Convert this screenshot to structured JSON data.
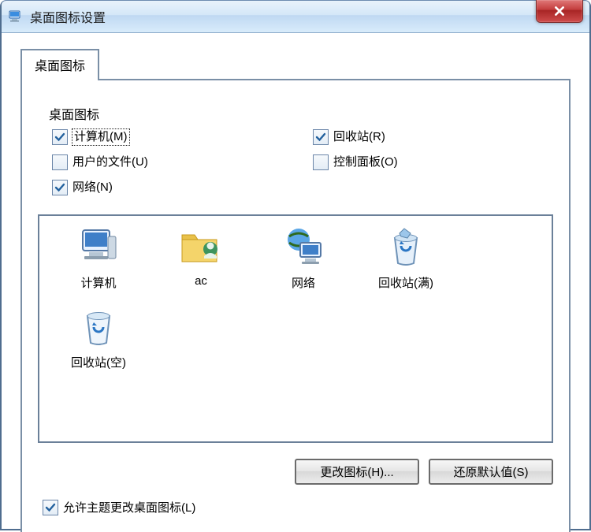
{
  "window": {
    "title": "桌面图标设置"
  },
  "tab": {
    "label": "桌面图标"
  },
  "group": {
    "legend": "桌面图标",
    "items": {
      "computer": {
        "label": "计算机(M)",
        "checked": true,
        "focused": true
      },
      "recycle": {
        "label": "回收站(R)",
        "checked": true,
        "focused": false
      },
      "userfiles": {
        "label": "用户的文件(U)",
        "checked": false,
        "focused": false
      },
      "control": {
        "label": "控制面板(O)",
        "checked": false,
        "focused": false
      },
      "network": {
        "label": "网络(N)",
        "checked": true,
        "focused": false
      }
    }
  },
  "iconlist": {
    "computer": "计算机",
    "userfolder": "ac",
    "network": "网络",
    "recycle_full": "回收站(满)",
    "recycle_empty": "回收站(空)"
  },
  "buttons": {
    "change": "更改图标(H)...",
    "restore": "还原默认值(S)"
  },
  "allowtheme": {
    "label": "允许主题更改桌面图标(L)",
    "checked": true
  }
}
